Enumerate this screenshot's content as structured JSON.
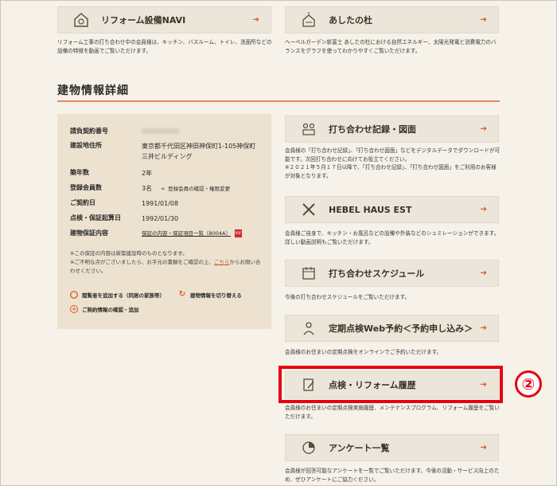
{
  "top_cards": [
    {
      "label": "リフォーム設備NAVI",
      "icon": "house-gear-icon",
      "desc": "リフォーム工事の打ち合わせ中の会員様は、キッチン、バスルーム、トイレ、洗面所などの設備の特徴を動画でご覧いただけます。"
    },
    {
      "label": "あしたの杜",
      "icon": "solar-house-icon",
      "desc": "ヘーベルガーデン新富士 あしたの杜における自然エネルギー、太陽光発電と消費電力のバランスをグラフを使ってわかりやすくご覧いただけます。"
    }
  ],
  "section": {
    "title": "建物情報詳細"
  },
  "building_info": {
    "rows": [
      {
        "key": "請負契約番号",
        "value": ""
      },
      {
        "key": "建設地住所",
        "value": "東京都千代田区神田神保町1-105神保町三井ビルディング"
      },
      {
        "key": "築年数",
        "value": "2年"
      },
      {
        "key": "登録会員数",
        "value": "3名",
        "link": "登録会員の確認・権限変更"
      },
      {
        "key": "ご契約日",
        "value": "1991/01/08"
      },
      {
        "key": "点検・保証起算日",
        "value": "1992/01/30"
      },
      {
        "key": "建物保証内容",
        "value": "保証の内容・保証項目一覧（8004A）",
        "pdf": "PDF"
      }
    ],
    "note1": "※この保証の内容は新築建設時のものとなります。",
    "note2a": "※ご不明な点がございましたら、お手元の書類をご確認の上、",
    "note2_link": "こちら",
    "note2b": "からお問い合わせください。",
    "actions": {
      "add_viewer": "閲覧者を追加する（同居の家族等）",
      "switch_building": "建物情報を切り替える",
      "add_contract": "ご契約情報の確認・追加"
    }
  },
  "right_cards": [
    {
      "label": "打ち合わせ記録・図面",
      "icon": "people-meeting-icon",
      "desc1": "会員様の「打ち合わせ記録」、「打ち合わせ図面」などをデジタルデータでダウンロードが可能です。次回打ち合わせに向けてお役立てください。",
      "desc2": "※２０２１年５月１７日以降で、「打ち合わせ記録」、「打ち合わせ図面」をご利用のお客様が対象となります。"
    },
    {
      "label": "HEBEL HAUS EST",
      "icon": "tools-icon",
      "desc1": "会員様ご自身で、キッチン・お風呂などの設備や外装などのシュミレーションができます。詳しい動画説明もご覧いただけます。",
      "desc2": ""
    },
    {
      "label": "打ち合わせスケジュール",
      "icon": "calendar-icon",
      "desc1": "今後の打ち合わせスケジュールをご覧いただけます。",
      "desc2": ""
    },
    {
      "label": "定期点検Web予約＜予約申し込み＞",
      "icon": "inspector-icon",
      "desc1": "会員様のお住まいの定期点検をオンラインでご予約いただけます。",
      "desc2": ""
    },
    {
      "label": "点検・リフォーム履歴",
      "icon": "document-pen-icon",
      "desc1": "会員様のお住まいの定期点検実施履歴、メンテナンスプログラム、リフォーム履歴をご覧いただけます。",
      "desc2": ""
    },
    {
      "label": "アンケート一覧",
      "icon": "pie-chart-icon",
      "desc1": "会員様が回答可能なアンケートを一覧でご覧いただけます。今後の活動・サービス向上のため、ぜひアンケートにご協力ください。",
      "desc2": ""
    }
  ],
  "annotation": {
    "badge": "②"
  },
  "colors": {
    "accent": "#e0572f",
    "highlight": "#e60012",
    "card_bg": "#ece5da",
    "info_bg": "#ece2cf"
  }
}
